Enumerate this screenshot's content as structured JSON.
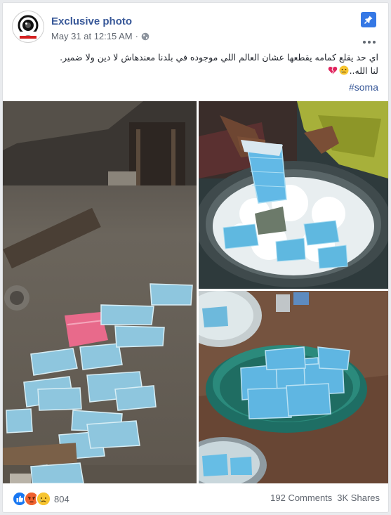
{
  "post": {
    "author": "Exclusive photo",
    "avatar_text": "EXCLUSIVE PHOTO",
    "date": "May 31 at 12:15 AM",
    "separator": "·",
    "privacy_icon": "globe-icon",
    "pin_icon": "pin-icon",
    "text_line1": "اي حد يقلع كمامه يقطعها عشان العالم اللي موجوده في بلدنا معندهاش لا دين ولا ضمير.",
    "text_line2": "لنا الله..",
    "hashtag": "#soma"
  },
  "footer": {
    "reactions": [
      "like-icon",
      "angry-icon",
      "sad-icon"
    ],
    "reaction_count": "804",
    "comments": "192 Comments",
    "shares": "3K Shares"
  },
  "colors": {
    "link": "#385898",
    "pin": "#3578e5",
    "like": "#1877f2",
    "angry": "#e9710f",
    "sad": "#f7b125"
  }
}
